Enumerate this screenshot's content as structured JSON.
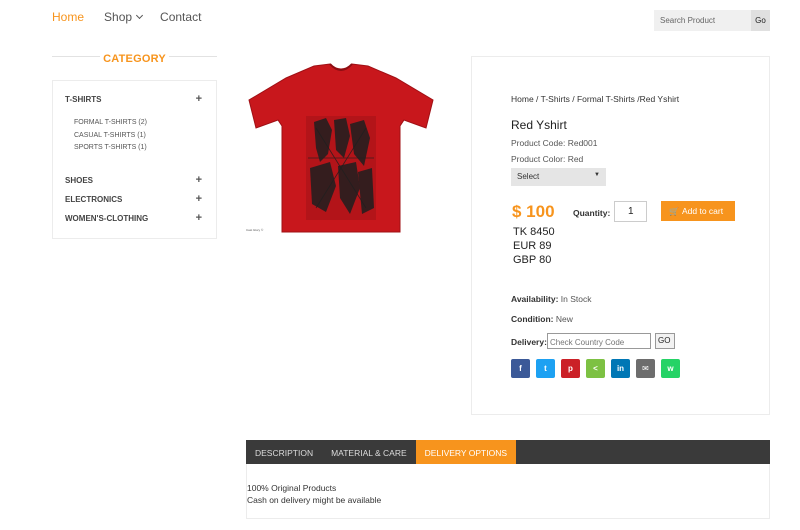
{
  "nav": {
    "home": "Home",
    "shop": "Shop",
    "contact": "Contact"
  },
  "search": {
    "placeholder": "Search Product",
    "button": "Go"
  },
  "category": {
    "heading": "CATEGORY",
    "items": [
      {
        "label": "T-SHIRTS",
        "sub": [
          "FORMAL T-SHIRTS (2)",
          "CASUAL T-SHIRTS (1)",
          "SPORTS T-SHIRTS (1)"
        ]
      },
      {
        "label": "SHOES"
      },
      {
        "label": "ELECTRONICS"
      },
      {
        "label": "WOMEN'S-CLOTHING"
      }
    ],
    "expand_glyph": "+"
  },
  "product": {
    "breadcrumb": "Home / T-Shirts / Formal T-Shirts /Red Yshirt",
    "name": "Red Yshirt",
    "code": "Product Code: Red001",
    "color": "Product Color: Red",
    "select_value": "Select",
    "price": "$ 100",
    "alt_prices": [
      "TK 8450",
      "EUR 89",
      "GBP 80"
    ],
    "quantity_label": "Quantity:",
    "quantity": "1",
    "add_to_cart": "Add to cart",
    "availability_label": "Availability:",
    "availability": "In Stock",
    "condition_label": "Condition:",
    "condition": "New",
    "delivery_label": "Delivery:",
    "delivery_placeholder": "Check Country Code",
    "delivery_go": "GO",
    "image_caption": "Cast Glory ©"
  },
  "share": [
    {
      "name": "facebook",
      "glyph": "f",
      "color": "#3b5998"
    },
    {
      "name": "twitter",
      "glyph": "t",
      "color": "#1da1f2"
    },
    {
      "name": "pinterest",
      "glyph": "p",
      "color": "#cb2027"
    },
    {
      "name": "share",
      "glyph": "<",
      "color": "#7dc143"
    },
    {
      "name": "linkedin",
      "glyph": "in",
      "color": "#0077b5"
    },
    {
      "name": "email",
      "glyph": "✉",
      "color": "#6d6d6d"
    },
    {
      "name": "whatsapp",
      "glyph": "w",
      "color": "#25d366"
    }
  ],
  "tabs": {
    "items": [
      "DESCRIPTION",
      "MATERIAL & CARE",
      "DELIVERY OPTIONS"
    ],
    "active": "DELIVERY OPTIONS",
    "content": [
      "100% Original Products",
      "Cash on delivery might be available"
    ]
  },
  "colors": {
    "accent": "#f7941d",
    "tab_bar": "#3a3a3a",
    "shirt": "#c8171c"
  }
}
